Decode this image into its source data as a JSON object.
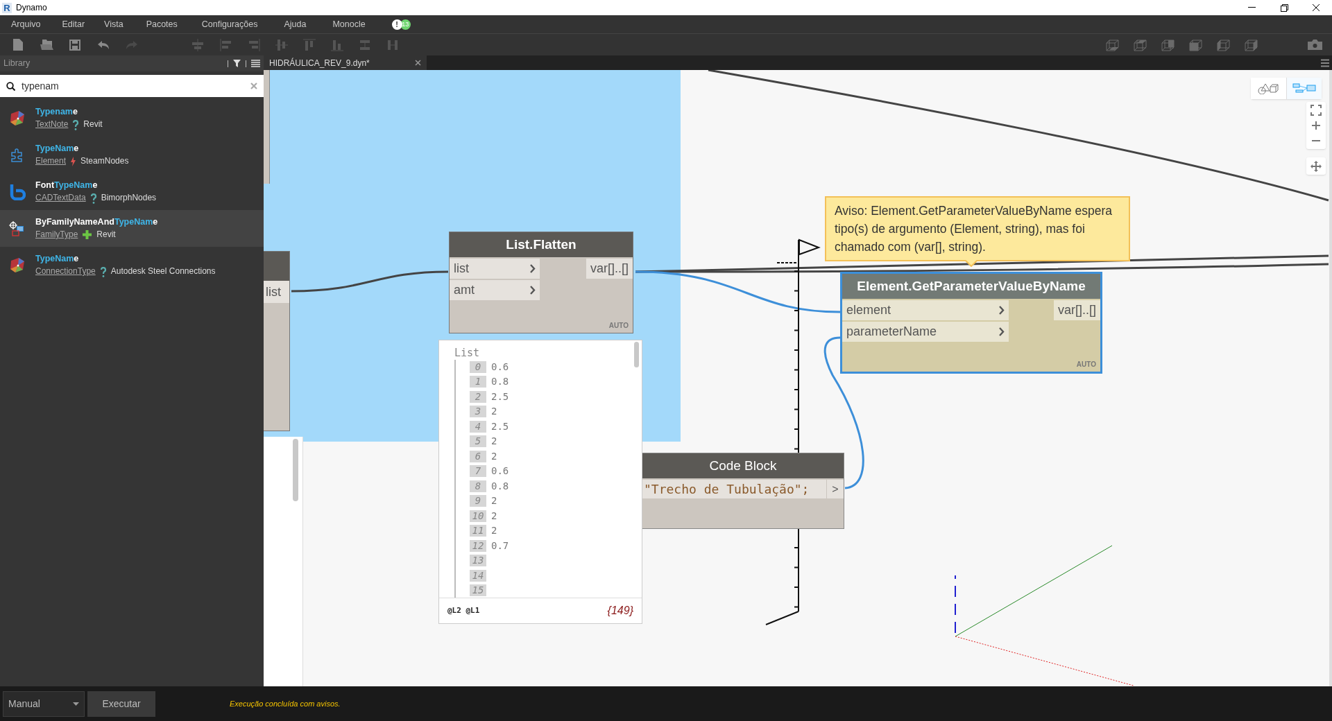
{
  "window": {
    "logo": "R",
    "title": "Dynamo"
  },
  "menu": [
    "Arquivo",
    "Editar",
    "Vista",
    "Pacotes",
    "Configurações",
    "Ajuda",
    "Monocle"
  ],
  "notifications": {
    "icon": "!",
    "count": "13"
  },
  "library": {
    "title": "Library",
    "search": {
      "value": "typenam"
    },
    "results": [
      {
        "kind": "gem",
        "match": "Typenam",
        "after": "e",
        "category": {
          "text": "TextNote",
          "kind": "query"
        },
        "source": "Revit",
        "selected": false
      },
      {
        "kind": "puzzle",
        "match": "TypeNam",
        "after": "e",
        "category": {
          "text": "Element",
          "kind": "action"
        },
        "source": "SteamNodes",
        "selected": false
      },
      {
        "kind": "curve",
        "before": "Font",
        "match": "TypeNam",
        "after": "e",
        "category": {
          "text": "CADTextData",
          "kind": "query"
        },
        "source": "BimorphNodes",
        "selected": false
      },
      {
        "kind": "family",
        "before": "ByFamilyNameAnd",
        "match": "TypeNam",
        "after": "e",
        "category": {
          "text": "FamilyType",
          "kind": "create"
        },
        "source": "Revit",
        "selected": true
      },
      {
        "kind": "gem",
        "match": "TypeNam",
        "after": "e",
        "category": {
          "text": "ConnectionType",
          "kind": "query"
        },
        "source": "Autodesk Steel Connections",
        "selected": false
      }
    ]
  },
  "tabs": [
    {
      "label": "HIDRÁULICA_REV_9.dyn*",
      "selected": true
    }
  ],
  "view_toggle": [
    {
      "kind": "geometry",
      "selected": false
    },
    {
      "kind": "graph",
      "selected": true
    }
  ],
  "canvas": {
    "left_node": {
      "port": "list"
    },
    "flatten": {
      "title": "List.Flatten",
      "inputs": [
        "list",
        "amt"
      ],
      "output": "var[]..[]",
      "lacing": "AUTO",
      "selected": false
    },
    "watch": {
      "header": "List",
      "items": [
        {
          "index": "0",
          "value": "0.6"
        },
        {
          "index": "1",
          "value": "0.8"
        },
        {
          "index": "2",
          "value": "2.5"
        },
        {
          "index": "3",
          "value": "2"
        },
        {
          "index": "4",
          "value": "2.5"
        },
        {
          "index": "5",
          "value": "2"
        },
        {
          "index": "6",
          "value": "2"
        },
        {
          "index": "7",
          "value": "0.6"
        },
        {
          "index": "8",
          "value": "0.8"
        },
        {
          "index": "9",
          "value": "2"
        },
        {
          "index": "10",
          "value": "2"
        },
        {
          "index": "11",
          "value": "2"
        },
        {
          "index": "12",
          "value": "0.7"
        },
        {
          "index": "13"
        },
        {
          "index": "14"
        },
        {
          "index": "15"
        }
      ],
      "levels": "@L2 @L1",
      "count": "{149}"
    },
    "code_block": {
      "title": "Code Block",
      "code": "\"Trecho de Tubulação\";",
      "output": ">"
    },
    "element_node": {
      "title": "Element.GetParameterValueByName",
      "inputs": [
        "element",
        "parameterName"
      ],
      "output": "var[]..[]",
      "lacing": "AUTO",
      "selected": true
    },
    "warning": {
      "text": "Aviso: Element.GetParameterValueByName espera tipo(s) de argumento (Element, string), mas foi chamado com (var[], string)."
    }
  },
  "run": {
    "mode": "Manual",
    "button": "Executar",
    "status": "Execução concluída com avisos."
  }
}
